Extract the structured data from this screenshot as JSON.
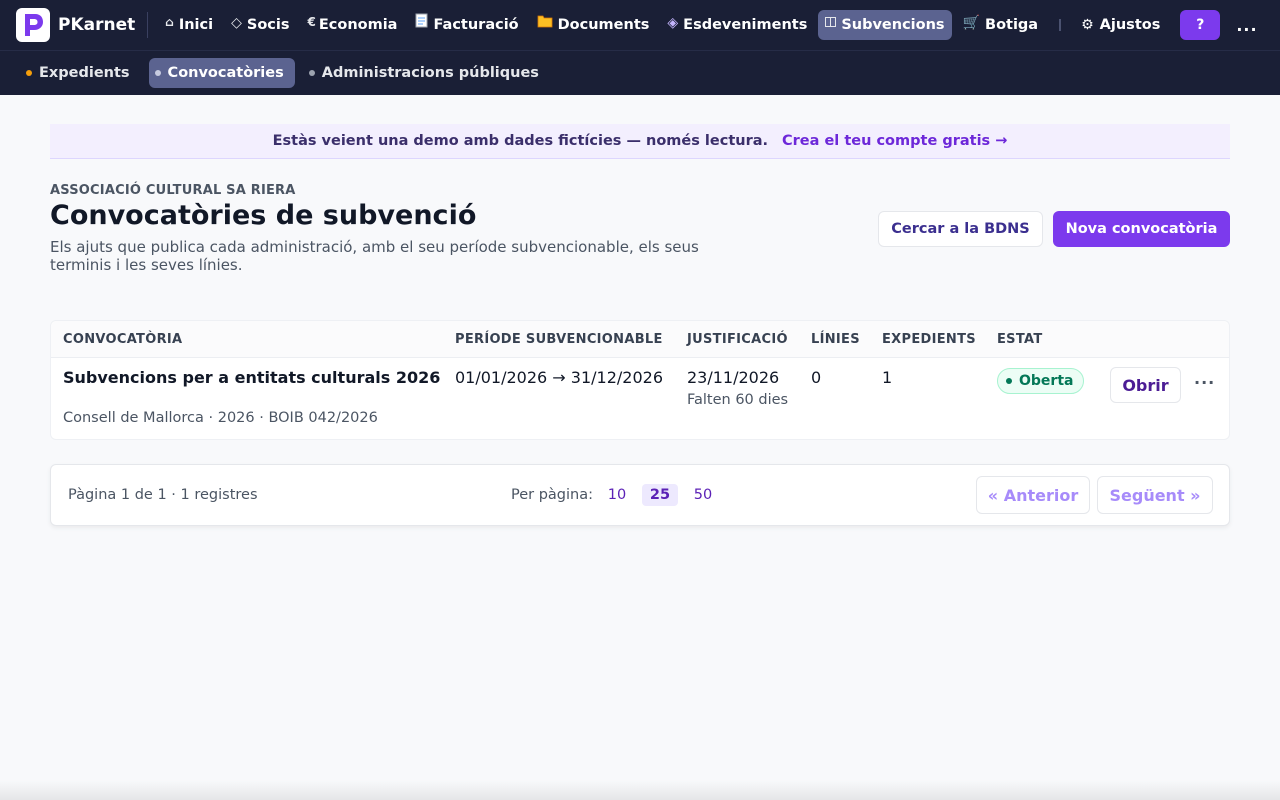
{
  "app": {
    "name": "PKarnet"
  },
  "nav": {
    "items": [
      {
        "label": "Inici",
        "icon": "home-icon"
      },
      {
        "label": "Socis",
        "icon": "diamond-icon"
      },
      {
        "label": "Economia",
        "icon": "euro-icon"
      },
      {
        "label": "Facturació",
        "icon": "receipt-icon"
      },
      {
        "label": "Documents",
        "icon": "folder-icon"
      },
      {
        "label": "Esdeveniments",
        "icon": "diamond-dot-icon"
      },
      {
        "label": "Subvencions",
        "icon": "book-icon",
        "active": true
      },
      {
        "label": "Botiga",
        "icon": "cart-icon"
      }
    ],
    "settings_label": "Ajustos",
    "help_label": "?",
    "more_label": "..."
  },
  "subnav": {
    "items": [
      {
        "label": "Expedients",
        "dot_color": "#f59e0b"
      },
      {
        "label": "Convocatòries",
        "active": true
      },
      {
        "label": "Administracions públiques"
      }
    ]
  },
  "banner": {
    "text": "Estàs veient una demo amb dades fictícies — només lectura.",
    "link": "Crea el teu compte gratis →"
  },
  "page": {
    "org": "ASSOCIACIÓ CULTURAL SA RIERA",
    "title": "Convocatòries de subvenció",
    "subtitle": "Els ajuts que publica cada administració, amb el seu període subvencionable, els seus terminis i les seves línies.",
    "search_bdns_label": "Cercar a la BDNS",
    "new_label": "Nova convocatòria"
  },
  "table": {
    "columns": [
      "CONVOCATÒRIA",
      "PERÍODE SUBVENCIONABLE",
      "JUSTIFICACIÓ",
      "LÍNIES",
      "EXPEDIENTS",
      "ESTAT"
    ],
    "rows": [
      {
        "title": "Subvencions per a entitats culturals 2026",
        "meta": "Consell de Mallorca · 2026 · BOIB 042/2026",
        "period": "01/01/2026 → 31/12/2026",
        "justification_date": "23/11/2026",
        "justification_remaining": "Falten 60 dies",
        "lines": "0",
        "files": "1",
        "status": "Oberta",
        "open_label": "Obrir",
        "more_label": "···"
      }
    ]
  },
  "pagination": {
    "info": "Pàgina 1 de 1 · 1 registres",
    "per_page_label": "Per pàgina:",
    "sizes": [
      "10",
      "25",
      "50"
    ],
    "selected_size": "25",
    "prev_label": "« Anterior",
    "next_label": "Següent »"
  },
  "colors": {
    "nav_bg": "#1a1f36",
    "accent": "#7c3aed",
    "status_open": "#047857"
  }
}
